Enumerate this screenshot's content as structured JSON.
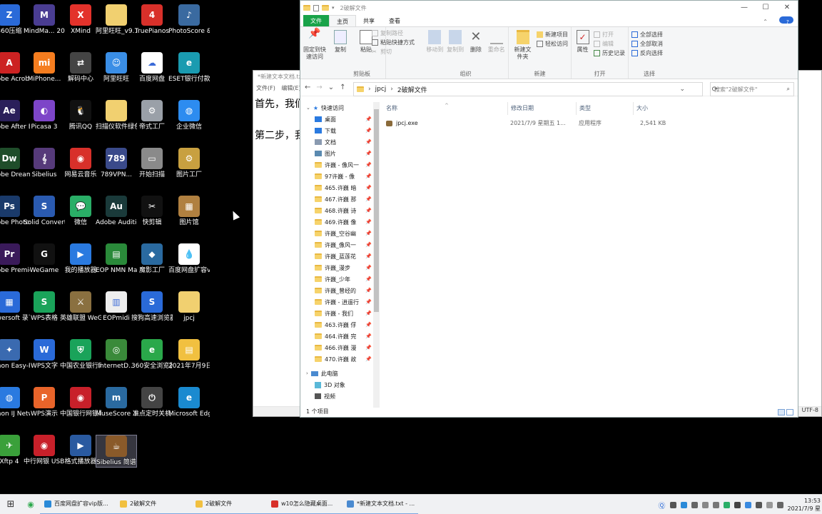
{
  "desktop_icons": [
    {
      "label": "360压缩",
      "color": "#2a6ad8",
      "glyph": "Z"
    },
    {
      "label": "MindMa... 2020",
      "color": "#4a3d92",
      "glyph": "M"
    },
    {
      "label": "XMind",
      "color": "#e3322b",
      "glyph": "X"
    },
    {
      "label": "阿里旺旺_v9.12.11...",
      "color": "#f1d070",
      "glyph": ""
    },
    {
      "label": "TruePianos",
      "color": "#d8302a",
      "glyph": "4"
    },
    {
      "label": "PhotoScore & Notate...",
      "color": "#3a6aa0",
      "glyph": "♪"
    },
    {
      "label": "Adobe Acrobat DC",
      "color": "#cc2222",
      "glyph": "A"
    },
    {
      "label": "MiPhone...",
      "color": "#f57d1f",
      "glyph": "mi"
    },
    {
      "label": "解码中心",
      "color": "#444444",
      "glyph": "⇄"
    },
    {
      "label": "阿里旺旺",
      "color": "#3a8ee6",
      "glyph": "☺"
    },
    {
      "label": "百度网盘",
      "color": "#ffffff",
      "glyph": "☁"
    },
    {
      "label": "ESET银行付款保护",
      "color": "#1a9bb0",
      "glyph": "e"
    },
    {
      "label": "Adobe After Effe...",
      "color": "#2a1f5a",
      "glyph": "Ae"
    },
    {
      "label": "Picasa 3",
      "color": "#7d45c8",
      "glyph": "◐"
    },
    {
      "label": "腾讯QQ",
      "color": "#111111",
      "glyph": "🐧"
    },
    {
      "label": "扫描仪软件绿色版",
      "color": "#f1d070",
      "glyph": ""
    },
    {
      "label": "帝式工厂",
      "color": "#9aa0a8",
      "glyph": "⚙"
    },
    {
      "label": "企业微信",
      "color": "#2d8cf0",
      "glyph": "◍"
    },
    {
      "label": "Adobe Dreamwe...",
      "color": "#1f4d2a",
      "glyph": "Dw"
    },
    {
      "label": "Sibelius",
      "color": "#563a7a",
      "glyph": "𝄞"
    },
    {
      "label": "网易云音乐",
      "color": "#d8302a",
      "glyph": "◉"
    },
    {
      "label": "789VPN...",
      "color": "#3a4a8a",
      "glyph": "789"
    },
    {
      "label": "开始扫描",
      "color": "#8a8a8a",
      "glyph": "▭"
    },
    {
      "label": "图片工厂",
      "color": "#c8a040",
      "glyph": "⚙"
    },
    {
      "label": "Adobe Photosh...",
      "color": "#1a3a6a",
      "glyph": "Ps"
    },
    {
      "label": "Solid Convert...",
      "color": "#2a5ab0",
      "glyph": "S"
    },
    {
      "label": "微信",
      "color": "#2aae67",
      "glyph": "💬"
    },
    {
      "label": "Adobe Audition",
      "color": "#1a3a3a",
      "glyph": "Au"
    },
    {
      "label": "快剪辑",
      "color": "#111111",
      "glyph": "✂"
    },
    {
      "label": "图片馆",
      "color": "#b08040",
      "glyph": "▦"
    },
    {
      "label": "Adobe Premie...",
      "color": "#3a1a5a",
      "glyph": "Pr"
    },
    {
      "label": "WeGame",
      "color": "#111111",
      "glyph": "G"
    },
    {
      "label": "我的播放器",
      "color": "#2a7ae0",
      "glyph": "▶"
    },
    {
      "label": "EOP NMN Master",
      "color": "#2a8a3a",
      "glyph": "▤"
    },
    {
      "label": "魔影工厂",
      "color": "#2a6aa0",
      "glyph": "◆"
    },
    {
      "label": "百度网盘扩容v1.4.exe",
      "color": "#ffffff",
      "glyph": "💧"
    },
    {
      "label": "Powersoft 录下载王",
      "color": "#2a6ad8",
      "glyph": "▦"
    },
    {
      "label": "WPS表格",
      "color": "#1aa35a",
      "glyph": "S"
    },
    {
      "label": "英雄联盟 WeGame版",
      "color": "#8a7040",
      "glyph": "⚔"
    },
    {
      "label": "EOPmidi",
      "color": "#eeeeee",
      "glyph": "▥"
    },
    {
      "label": "搜狗高速浏览器",
      "color": "#2a6ad8",
      "glyph": "S"
    },
    {
      "label": "jpcj",
      "color": "#f1d070",
      "glyph": ""
    },
    {
      "label": "Canon Easy-Pho...",
      "color": "#3a6ab0",
      "glyph": "✦"
    },
    {
      "label": "WPS文字",
      "color": "#2a6ad8",
      "glyph": "W"
    },
    {
      "label": "中国农业银行网银助手",
      "color": "#1aa35a",
      "glyph": "⛨"
    },
    {
      "label": "InternetD...",
      "color": "#3a8a3a",
      "glyph": "◎"
    },
    {
      "label": "360安全浏览器",
      "color": "#2aa84a",
      "glyph": "e"
    },
    {
      "label": "2021年7月9日整理...",
      "color": "#f1c040",
      "glyph": "▤"
    },
    {
      "label": "Canon IJ Netwo...",
      "color": "#2a7ae0",
      "glyph": "◍"
    },
    {
      "label": "WPS演示",
      "color": "#e8642a",
      "glyph": "P"
    },
    {
      "label": "中国银行网银助手",
      "color": "#c8202a",
      "glyph": "◉"
    },
    {
      "label": "MuseScore 3",
      "color": "#2a6aa0",
      "glyph": "m"
    },
    {
      "label": "准点定时关机",
      "color": "#444444",
      "glyph": "⏻"
    },
    {
      "label": "Microsoft Edge",
      "color": "#1a8ad0",
      "glyph": "e"
    },
    {
      "label": "Xftp 4",
      "color": "#3aa03a",
      "glyph": "✈"
    },
    {
      "label": "中行网银 USBKey数...",
      "color": "#c8202a",
      "glyph": "◉"
    },
    {
      "label": "格式播放器",
      "color": "#2a5aa0",
      "glyph": "▶"
    },
    {
      "label": "Sibelius 简谱插件 V8",
      "color": "#8a5a2a",
      "glyph": "☕"
    }
  ],
  "notepad": {
    "title": "*新建文本文档.txt - 记事本",
    "menu": [
      "文件(F)",
      "编辑(E)"
    ],
    "lines": [
      "首先，我们",
      "第二步，我"
    ],
    "encoding": "UTF-8"
  },
  "explorer": {
    "title": "2破解文件",
    "window_controls": [
      "—",
      "☐",
      "✕"
    ],
    "tabs": [
      "文件",
      "主页",
      "共享",
      "查看"
    ],
    "ribbon": {
      "clipboard": {
        "name": "剪贴板",
        "pin": "固定到快速访问",
        "copy": "复制",
        "paste": "粘贴",
        "copy_path": "复制路径",
        "paste_shortcut": "粘贴快捷方式",
        "cut": "剪切"
      },
      "organize": {
        "name": "组织",
        "move_to": "移动到",
        "copy_to": "复制到",
        "delete": "删除",
        "rename": "重命名"
      },
      "new": {
        "name": "新建",
        "new_folder": "新建文件夹",
        "new_item": "新建项目",
        "easy_access": "轻松访问"
      },
      "open": {
        "name": "打开",
        "properties": "属性",
        "open": "打开",
        "edit": "编辑",
        "history": "历史记录"
      },
      "select": {
        "name": "选择",
        "select_all": "全部选择",
        "select_none": "全部取消",
        "invert": "反向选择"
      }
    },
    "address": [
      "jpcj",
      "2破解文件"
    ],
    "search_placeholder": "搜索\"2破解文件\"",
    "nav": {
      "quick_access": "快速访问",
      "items": [
        {
          "label": "桌面",
          "pinned": true,
          "kind": "desktop"
        },
        {
          "label": "下载",
          "pinned": true,
          "kind": "download"
        },
        {
          "label": "文档",
          "pinned": true,
          "kind": "doc"
        },
        {
          "label": "图片",
          "pinned": true,
          "kind": "pic"
        },
        {
          "label": "许巍 - 像风一",
          "pinned": true,
          "kind": "folder"
        },
        {
          "label": "97许巍 - 像",
          "pinned": true,
          "kind": "folder"
        },
        {
          "label": "465.许巍 暗",
          "pinned": true,
          "kind": "folder"
        },
        {
          "label": "467.许巍 那",
          "pinned": true,
          "kind": "folder"
        },
        {
          "label": "468.许巍 诗",
          "pinned": true,
          "kind": "folder"
        },
        {
          "label": "469.许巍 像",
          "pinned": true,
          "kind": "folder"
        },
        {
          "label": "许巍_空谷幽",
          "pinned": true,
          "kind": "folder"
        },
        {
          "label": "许巍_像风一",
          "pinned": true,
          "kind": "folder"
        },
        {
          "label": "许巍_蓝莲花",
          "pinned": true,
          "kind": "folder"
        },
        {
          "label": "许巍_漫步",
          "pinned": true,
          "kind": "folder"
        },
        {
          "label": "许巍_少年",
          "pinned": true,
          "kind": "folder"
        },
        {
          "label": "许巍_曾经的",
          "pinned": true,
          "kind": "folder"
        },
        {
          "label": "许巍 - 逍遥行",
          "pinned": true,
          "kind": "folder"
        },
        {
          "label": "许巍 - 我们",
          "pinned": true,
          "kind": "folder"
        },
        {
          "label": "463.许巍 俘",
          "pinned": true,
          "kind": "folder"
        },
        {
          "label": "464.许巍 完",
          "pinned": true,
          "kind": "folder"
        },
        {
          "label": "466.许巍 漫",
          "pinned": true,
          "kind": "folder"
        },
        {
          "label": "470.许巍 故",
          "pinned": true,
          "kind": "folder"
        }
      ],
      "this_pc": "此电脑",
      "pc_items": [
        "3D 对象",
        "视频"
      ]
    },
    "columns": [
      "名称",
      "修改日期",
      "类型",
      "大小"
    ],
    "files": [
      {
        "name": "jpcj.exe",
        "modified": "2021/7/9 星期五 1...",
        "type": "应用程序",
        "size": "2,541 KB"
      }
    ],
    "status": "1 个项目"
  },
  "taskbar": {
    "tasks": [
      {
        "label": "百度网盘扩容vip版...",
        "color": "#2a8ad8"
      },
      {
        "label": "2破解文件",
        "color": "#f1c040"
      },
      {
        "label": "2破解文件",
        "color": "#f1c040"
      },
      {
        "label": "w10怎么隐藏桌面...",
        "color": "#d8302a"
      },
      {
        "label": "*新建文本文档.txt - ...",
        "color": "#4a8ad0"
      }
    ],
    "time": "13:53",
    "date": "2021/7/9 星"
  }
}
